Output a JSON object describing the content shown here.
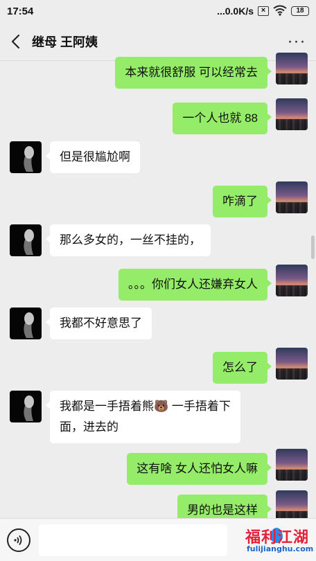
{
  "status_bar": {
    "time": "17:54",
    "network_speed": "...0.0K/s",
    "sim_icon": "no-sim-icon",
    "wifi_icon": "wifi-icon",
    "battery": "18"
  },
  "header": {
    "title": "继母 王阿姨",
    "back_icon": "back-arrow-icon",
    "more_icon": "more-dots-icon"
  },
  "messages": [
    {
      "from": "me",
      "text": "本来就很舒服  可以经常去"
    },
    {
      "from": "me",
      "text": "一个人也就 88"
    },
    {
      "from": "them",
      "text": "但是很尴尬啊"
    },
    {
      "from": "me",
      "text": "咋滴了"
    },
    {
      "from": "them",
      "text": "那么多女的，一丝不挂的，"
    },
    {
      "from": "me",
      "text": "。。。你们女人还嫌弃女人"
    },
    {
      "from": "them",
      "text": "我都不好意思了"
    },
    {
      "from": "me",
      "text": "怎么了"
    },
    {
      "from": "them",
      "text_line1": "我都是一手捂着熊🐻 一手捂着下",
      "text_line2": "面，进去的"
    },
    {
      "from": "me",
      "text": "这有啥  女人还怕女人嘛"
    },
    {
      "from": "me",
      "text": "男的也是这样"
    }
  ],
  "input_bar": {
    "voice_icon": "voice-icon",
    "placeholder": ""
  },
  "watermark": {
    "main": "福利江湖",
    "sub": "fulijianghu.com"
  },
  "colors": {
    "my_bubble": "#95ec69",
    "their_bubble": "#ffffff",
    "background": "#ededed",
    "watermark_red": "#e5213a",
    "watermark_blue": "#1a64c8"
  }
}
